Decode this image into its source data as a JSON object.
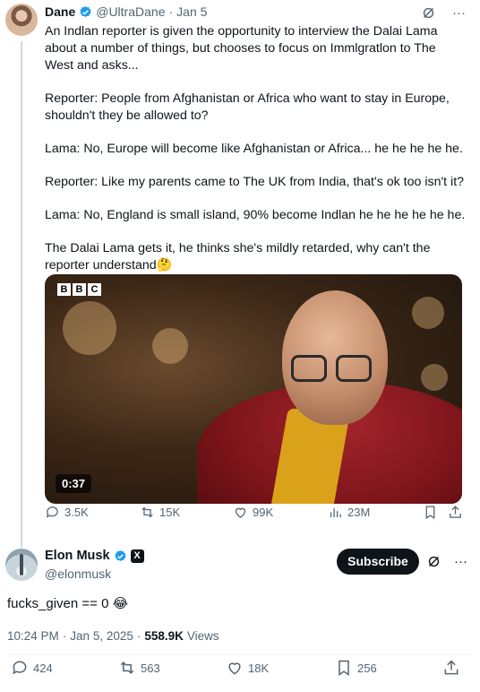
{
  "parent_tweet": {
    "name": "Dane",
    "handle": "@UltraDane",
    "date": "Jan 5",
    "paragraphs": [
      "An Indlan reporter is given the opportunity to interview the Dalai Lama about a number of things, but chooses to focus on Immlgratlon to The West and asks...",
      "Reporter: People from Afghanistan or Africa who want to stay in Europe, shouldn't they be allowed to?",
      "Lama:  No, Europe will become like Afghanistan or Africa... he he he he he.",
      "Reporter: Like my parents came to The UK from India, that's ok too isn't it?",
      "Lama: No, England is small island, 90% become Indlan he he he he he he.",
      "The Dalai Lama gets it, he thinks she's mildly retarded, why can't the reporter understand🤔"
    ],
    "video": {
      "broadcaster_letters": [
        "B",
        "B",
        "C"
      ],
      "duration": "0:37"
    },
    "stats": {
      "replies": "3.5K",
      "reposts": "15K",
      "likes": "99K",
      "views": "23M"
    }
  },
  "main_tweet": {
    "name": "Elon Musk",
    "badge": "X",
    "handle": "@elonmusk",
    "subscribe_label": "Subscribe",
    "text": "fucks_given == 0 😂",
    "time": "10:24 PM",
    "date": "Jan 5, 2025",
    "views_count": "558.9K",
    "views_label": "Views",
    "stats": {
      "replies": "424",
      "reposts": "563",
      "likes": "18K",
      "bookmarks": "256"
    }
  },
  "colors": {
    "verified_blue": "#1d9bf0",
    "secondary_text": "#536471",
    "primary_text": "#0f1419"
  }
}
